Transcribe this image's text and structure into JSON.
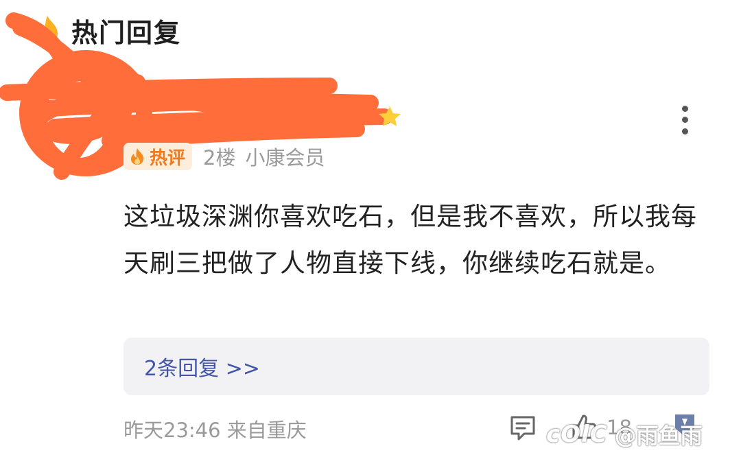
{
  "section": {
    "title": "热门回复",
    "icon": "flame-icon"
  },
  "comment": {
    "hot_badge_label": "热评",
    "floor": "2楼",
    "member_label": "小康会员",
    "text": "这垃圾深渊你喜欢吃石，但是我不喜欢，所以我每天刷三把做了人物直接下线，你继续吃石就是。",
    "replies_link": "2条回复 >>",
    "time_location": "昨天23:46 来自重庆",
    "like_count": "18"
  },
  "watermark": {
    "logo": "cOlC",
    "handle": "@雨鱼雨"
  },
  "colors": {
    "scribble": "#ff6d3a",
    "badge_text": "#f07a1c",
    "badge_bg": "#fdeedb",
    "link": "#4255a8",
    "muted": "#9a9a9a",
    "reply_box_bg": "#f2f2f4"
  }
}
